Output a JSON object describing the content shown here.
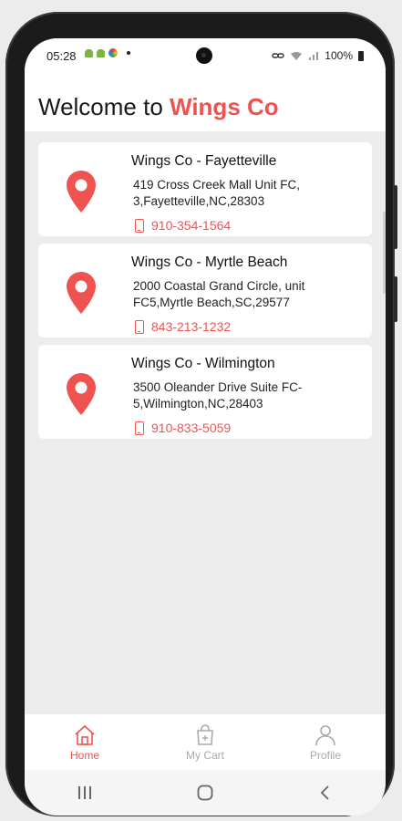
{
  "status_bar": {
    "time": "05:28",
    "battery": "100%"
  },
  "header": {
    "welcome_text": "Welcome to ",
    "brand": "Wings Co",
    "brand_color": "#ef5350"
  },
  "locations": [
    {
      "name": "Wings Co - Fayetteville",
      "address": "419 Cross Creek Mall Unit FC, 3,Fayetteville,NC,28303",
      "phone": "910-354-1564"
    },
    {
      "name": "Wings Co - Myrtle Beach",
      "address": "2000 Coastal Grand Circle, unit FC5,Myrtle Beach,SC,29577",
      "phone": "843-213-1232"
    },
    {
      "name": "Wings Co - Wilmington",
      "address": "3500 Oleander Drive Suite FC-5,Wilmington,NC,28403",
      "phone": "910-833-5059"
    }
  ],
  "bottom_nav": [
    {
      "label": "Home",
      "icon": "home-icon",
      "active": true
    },
    {
      "label": "My Cart",
      "icon": "cart-icon",
      "active": false
    },
    {
      "label": "Profile",
      "icon": "profile-icon",
      "active": false
    }
  ],
  "icons": {
    "location": "map-pin-icon",
    "phone": "phone-icon"
  }
}
